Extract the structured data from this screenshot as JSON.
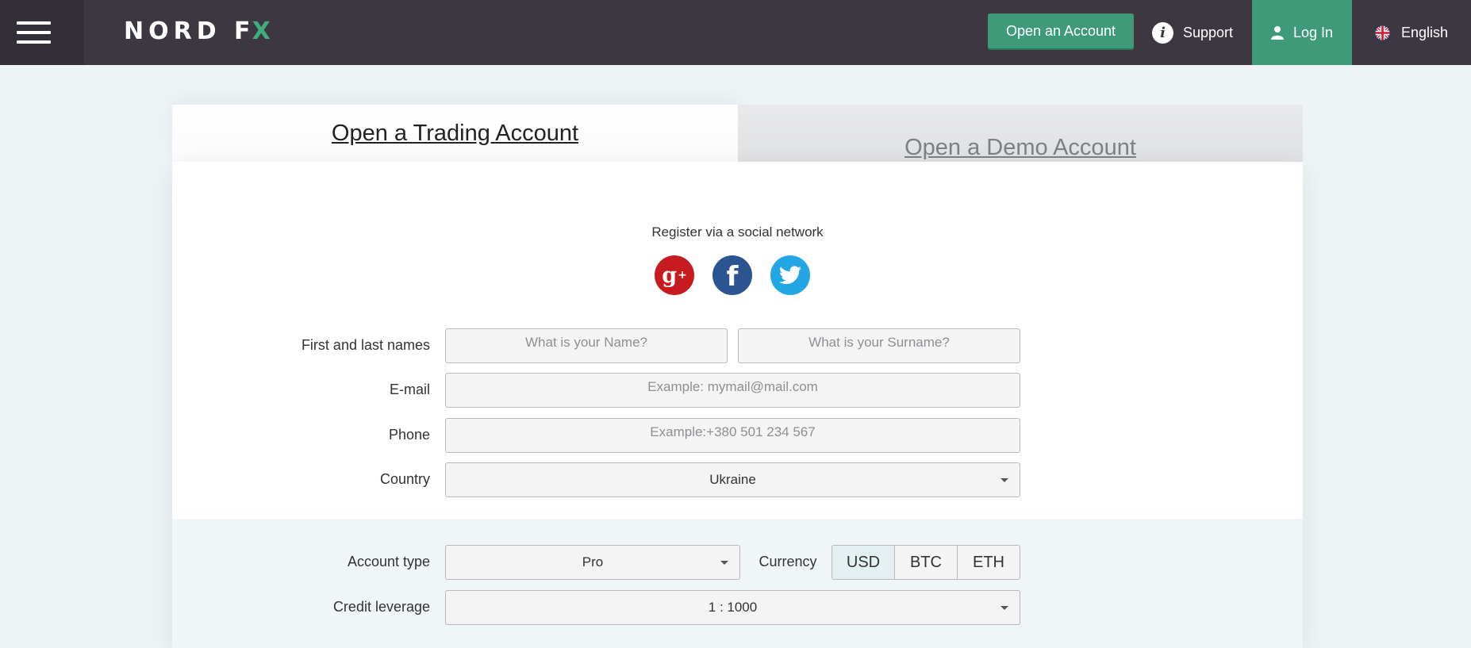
{
  "header": {
    "logo_main": "NORD F",
    "logo_x": "X",
    "open_account_label": "Open an Account",
    "support_label": "Support",
    "login_label": "Log In",
    "language_label": "English"
  },
  "tabs": [
    {
      "label": "Open a Trading Account",
      "active": true
    },
    {
      "label": "Open a Demo Account",
      "active": false
    }
  ],
  "social": {
    "title": "Register via a social network",
    "networks": [
      "google-plus",
      "facebook",
      "twitter"
    ]
  },
  "form": {
    "names_label": "First and last names",
    "first_name_placeholder": "What is your Name?",
    "surname_placeholder": "What is your Surname?",
    "email_label": "E-mail",
    "email_placeholder": "Example: mymail@mail.com",
    "phone_label": "Phone",
    "phone_placeholder": "Example:+380 501 234 567",
    "country_label": "Country",
    "country_value": "Ukraine",
    "account_type_label": "Account type",
    "account_type_value": "Pro",
    "currency_label": "Currency",
    "currencies": [
      "USD",
      "BTC",
      "ETH"
    ],
    "selected_currency": "USD",
    "leverage_label": "Credit leverage",
    "leverage_value": "1 : 1000"
  },
  "colors": {
    "header_bg": "#3d3741",
    "accent_green": "#3f9a79",
    "google_red": "#c71b1f",
    "facebook_blue": "#2b5590",
    "twitter_blue": "#22a6e4"
  }
}
